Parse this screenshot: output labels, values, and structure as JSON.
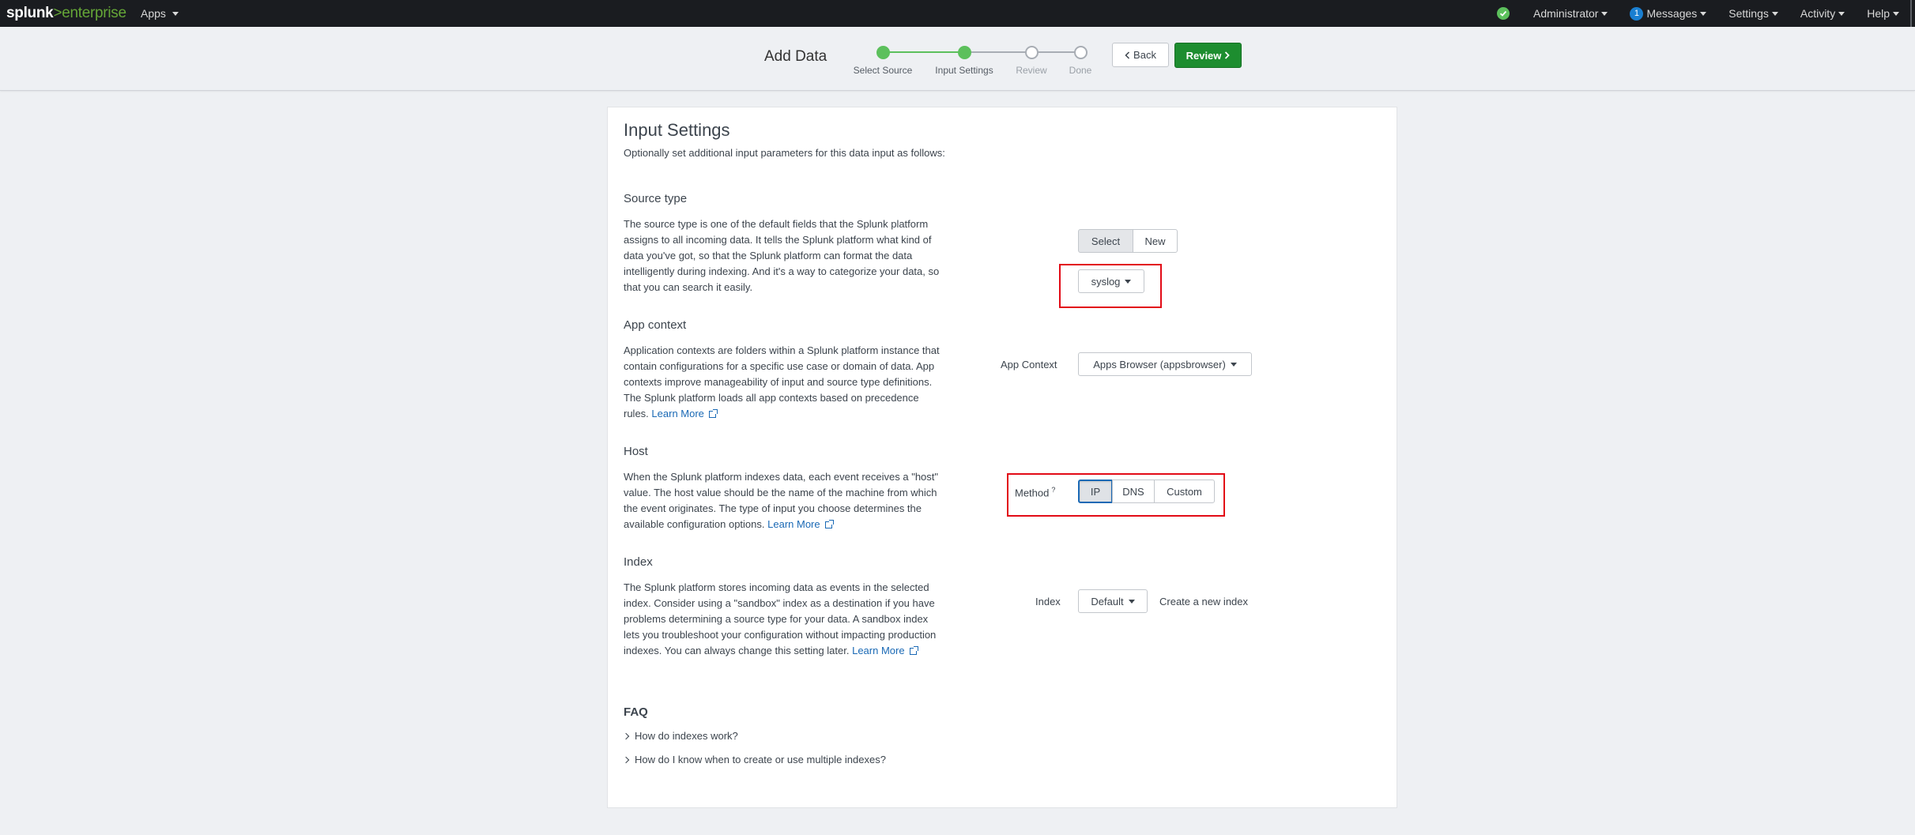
{
  "nav": {
    "logo_splunk": "splunk",
    "logo_gt": ">",
    "logo_enterprise": "enterprise",
    "apps": "Apps",
    "administrator": "Administrator",
    "messages_count": "1",
    "messages": "Messages",
    "settings": "Settings",
    "activity": "Activity",
    "help": "Help"
  },
  "wizard": {
    "title": "Add Data",
    "steps": [
      {
        "label": "Select Source",
        "state": "done"
      },
      {
        "label": "Input Settings",
        "state": "done"
      },
      {
        "label": "Review",
        "state": "todo"
      },
      {
        "label": "Done",
        "state": "todo"
      }
    ],
    "back": "Back",
    "review": "Review"
  },
  "panel": {
    "title": "Input Settings",
    "subtitle": "Optionally set additional input parameters for this data input as follows:",
    "source_type": {
      "heading": "Source type",
      "desc": "The source type is one of the default fields that the Splunk platform assigns to all incoming data. It tells the Splunk platform what kind of data you've got, so that the Splunk platform can format the data intelligently during indexing. And it's a way to categorize your data, so that you can search it easily.",
      "select": "Select",
      "new": "New",
      "value": "syslog"
    },
    "app_context": {
      "heading": "App context",
      "desc": "Application contexts are folders within a Splunk platform instance that contain configurations for a specific use case or domain of data. App contexts improve manageability of input and source type definitions. The Splunk platform loads all app contexts based on precedence rules.",
      "learn_more": "Learn More",
      "label": "App Context",
      "value": "Apps Browser (appsbrowser)"
    },
    "host": {
      "heading": "Host",
      "desc": "When the Splunk platform indexes data, each event receives a \"host\" value. The host value should be the name of the machine from which the event originates. The type of input you choose determines the available configuration options.",
      "learn_more": "Learn More",
      "method_label": "Method",
      "help_mark": "?",
      "options": [
        "IP",
        "DNS",
        "Custom"
      ]
    },
    "index": {
      "heading": "Index",
      "desc": "The Splunk platform stores incoming data as events in the selected index. Consider using a \"sandbox\" index as a destination if you have problems determining a source type for your data. A sandbox index lets you troubleshoot your configuration without impacting production indexes. You can always change this setting later.",
      "learn_more": "Learn More",
      "label": "Index",
      "value": "Default",
      "create": "Create a new index"
    },
    "faq": {
      "heading": "FAQ",
      "items": [
        "How do indexes work?",
        "How do I know when to create or use multiple indexes?"
      ]
    }
  }
}
